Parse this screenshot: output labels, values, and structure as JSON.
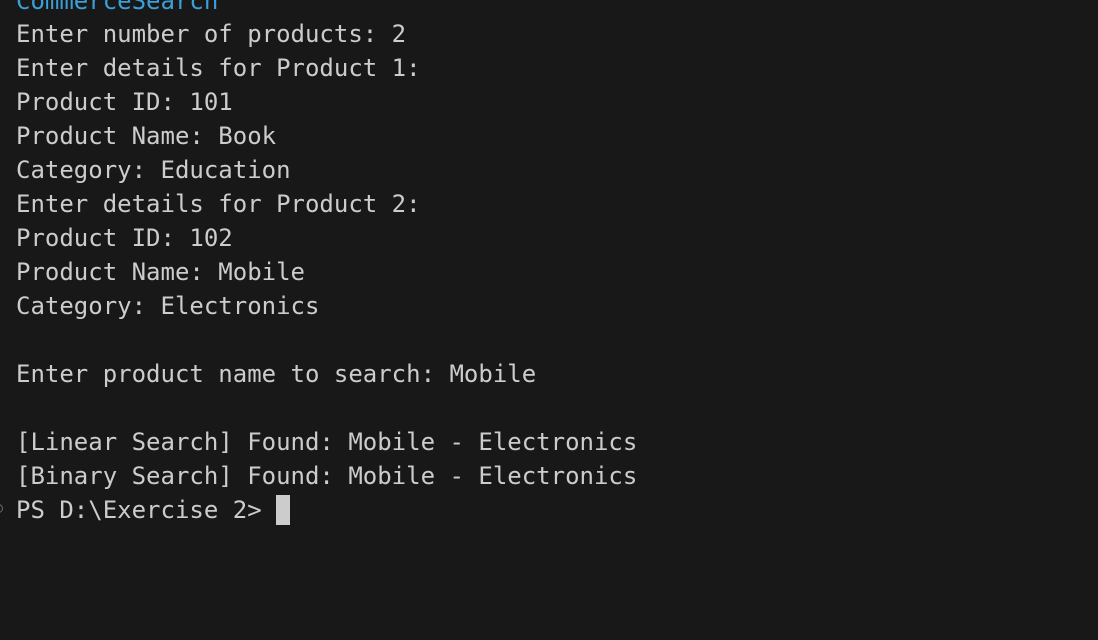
{
  "terminal": {
    "header": "CommerceSearch",
    "lines": [
      "Enter number of products: 2",
      "Enter details for Product 1:",
      "Product ID: 101",
      "Product Name: Book",
      "Category: Education",
      "Enter details for Product 2:",
      "Product ID: 102",
      "Product Name: Mobile",
      "Category: Electronics",
      "Enter product name to search: Mobile",
      "[Linear Search] Found: Mobile - Electronics",
      "[Binary Search] Found: Mobile - Electronics"
    ],
    "prompt": "PS D:\\Exercise 2>"
  },
  "colors": {
    "background": "#181818",
    "text": "#cccccc",
    "header": "#3b9fd8"
  }
}
